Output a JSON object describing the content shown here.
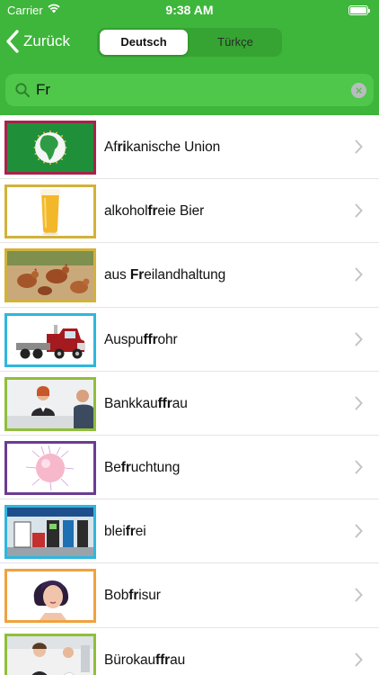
{
  "status": {
    "carrier": "Carrier",
    "time": "9:38 AM"
  },
  "nav": {
    "back_label": "Zurück",
    "segments": [
      {
        "label": "Deutsch",
        "selected": true
      },
      {
        "label": "Türkçe",
        "selected": false
      }
    ]
  },
  "search": {
    "value": "Fr"
  },
  "colors": {
    "header": "#3eb53b",
    "search_bg": "#4ec74b",
    "text": "#111111"
  },
  "list": [
    {
      "pre": "Af",
      "hit": "ri",
      "post": "kanische Union",
      "frame_color": "#a6234a",
      "image": "african-union-flag"
    },
    {
      "pre": "alkohol",
      "hit": "fr",
      "post": "eie Bier",
      "frame_color": "#d2b23a",
      "image": "beer-glass"
    },
    {
      "pre": "aus ",
      "hit": "Fr",
      "post": "eilandhaltung",
      "frame_color": "#d2b23a",
      "image": "chickens"
    },
    {
      "pre": "Auspu",
      "hit": "ffr",
      "post": "ohr",
      "frame_color": "#2fb6dd",
      "image": "truck"
    },
    {
      "pre": "Bankkau",
      "hit": "ffr",
      "post": "au",
      "frame_color": "#8fbf3a",
      "image": "bank-office"
    },
    {
      "pre": "Be",
      "hit": "fr",
      "post": "uchtung",
      "frame_color": "#6b3c93",
      "image": "fertilization"
    },
    {
      "pre": "blei",
      "hit": "fr",
      "post": "ei",
      "frame_color": "#2fb6dd",
      "image": "gas-station"
    },
    {
      "pre": "Bob",
      "hit": "fr",
      "post": "isur",
      "frame_color": "#f0a23e",
      "image": "bob-haircut"
    },
    {
      "pre": "Bürokau",
      "hit": "ffr",
      "post": "au",
      "frame_color": "#8fbf3a",
      "image": "office-women"
    }
  ]
}
